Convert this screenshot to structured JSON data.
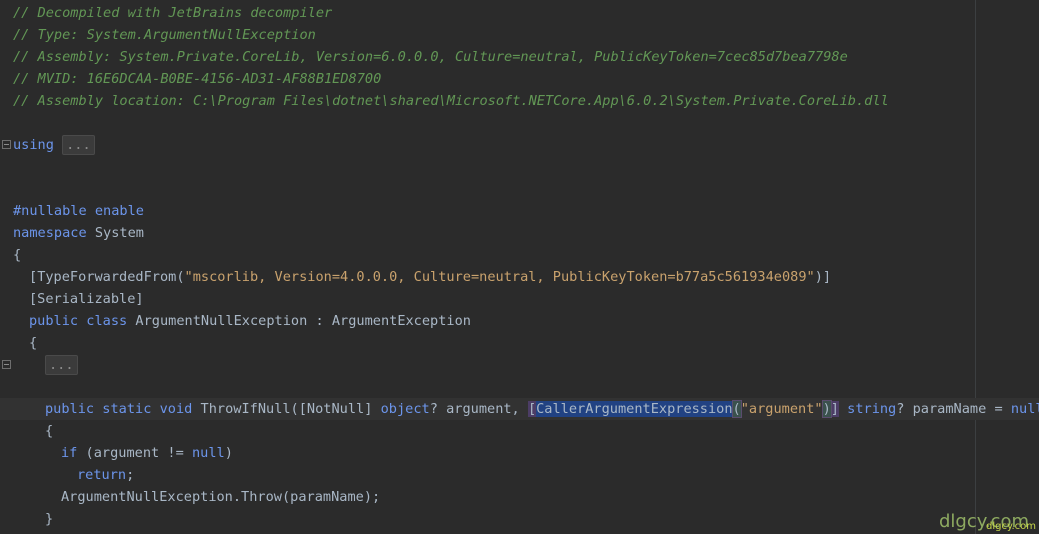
{
  "editor": {
    "header_comments": [
      "// Decompiled with JetBrains decompiler",
      "// Type: System.ArgumentNullException",
      "// Assembly: System.Private.CoreLib, Version=6.0.0.0, Culture=neutral, PublicKeyToken=7cec85d7bea7798e",
      "// MVID: 16E6DCAA-B0BE-4156-AD31-AF88B1ED8700",
      "// Assembly location: C:\\Program Files\\dotnet\\shared\\Microsoft.NETCore.App\\6.0.2\\System.Private.CoreLib.dll"
    ],
    "using_kw": "using",
    "using_folded": "...",
    "nullable_directive": "#nullable enable",
    "namespace_kw": "namespace",
    "namespace_name": "System",
    "open_brace": "{",
    "close_brace": "}",
    "attr1_open": "[",
    "attr1_name": "TypeForwardedFrom",
    "attr1_paren_open": "(",
    "attr1_value": "\"mscorlib, Version=4.0.0.0, Culture=neutral, PublicKeyToken=b77a5c561934e089\"",
    "attr1_paren_close": ")]",
    "attr2": "[Serializable]",
    "class_public": "public",
    "class_kw": "class",
    "class_name": "ArgumentNullException",
    "class_colon": " : ",
    "class_base": "ArgumentException",
    "class_folded": "...",
    "method_public": "public",
    "method_static": "static",
    "method_void": "void",
    "method_name": "ThrowIfNull(",
    "method_attr_notnull": "[NotNull]",
    "method_object": "object",
    "method_arg": "? argument, ",
    "method_attr_caller_open": "[",
    "method_attr_caller": "CallerArgumentExpression",
    "method_attr_caller_paren": "(",
    "method_attr_caller_value": "\"argument\"",
    "method_attr_caller_close_paren": ")",
    "method_attr_caller_close": "]",
    "method_string": "string",
    "method_param": "? paramName = ",
    "method_null": "null",
    "method_close": ")",
    "if_kw": "if",
    "if_cond": " (argument != ",
    "if_null": "null",
    "if_close": ")",
    "return_kw": "return",
    "return_semi": ";",
    "throw_stmt": "ArgumentNullException.Throw(paramName);"
  },
  "watermark": {
    "main": "dlgcy.com",
    "small": "dlgcy.com"
  },
  "colors": {
    "background": "#2b2b2b",
    "comment": "#629755",
    "keyword": "#6c95eb",
    "string": "#c9a26d",
    "identifier": "#a9b7c6"
  }
}
